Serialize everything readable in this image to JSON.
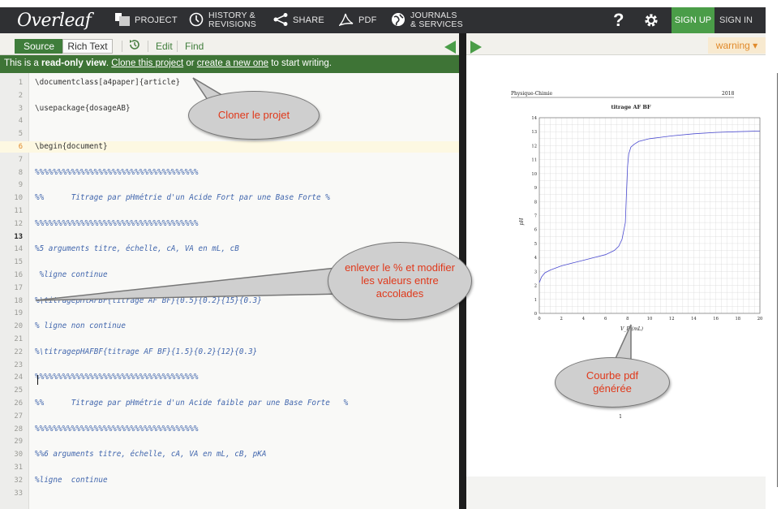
{
  "app": {
    "logo": "Overleaf"
  },
  "nav": {
    "project": "PROJECT",
    "history_line1": "HISTORY &",
    "history_line2": "REVISIONS",
    "share": "SHARE",
    "pdf": "PDF",
    "journals_line1": "JOURNALS",
    "journals_line2": "& SERVICES",
    "help": "?",
    "sign_up": "SIGN UP",
    "sign_in": "SIGN IN"
  },
  "toolbar": {
    "source": "Source",
    "rich_text": "Rich Text",
    "edit": "Edit",
    "find": "Find",
    "warning": "warning ▾"
  },
  "banner": {
    "prefix": "This is a ",
    "readonly": "read-only view",
    "sep1": ". ",
    "clone": "Clone this project",
    "or": " or ",
    "create": "create a new one",
    "suffix": " to start writing."
  },
  "editor": {
    "lines": [
      {
        "n": "1",
        "t": "\\documentclass[a4paper]{article}",
        "k": "code"
      },
      {
        "n": "2",
        "t": "",
        "k": "code"
      },
      {
        "n": "3",
        "t": "\\usepackage{dosageAB}",
        "k": "code"
      },
      {
        "n": "4",
        "t": "",
        "k": "code"
      },
      {
        "n": "5",
        "t": "",
        "k": "code"
      },
      {
        "n": "6",
        "t": "\\begin{document}",
        "k": "code"
      },
      {
        "n": "7",
        "t": "",
        "k": "code"
      },
      {
        "n": "8",
        "t": "%%%%%%%%%%%%%%%%%%%%%%%%%%%%%%%%%%%%",
        "k": "cmt"
      },
      {
        "n": "9",
        "t": "",
        "k": "code"
      },
      {
        "n": "10",
        "t": "%%      Titrage par pHmétrie d'un Acide Fort par une Base Forte %",
        "k": "cmt"
      },
      {
        "n": "11",
        "t": "",
        "k": "code"
      },
      {
        "n": "12",
        "t": "%%%%%%%%%%%%%%%%%%%%%%%%%%%%%%%%%%%%",
        "k": "cmt"
      },
      {
        "n": "13",
        "t": "",
        "k": "code"
      },
      {
        "n": "14",
        "t": "%5 arguments titre, échelle, cA, VA en mL, cB",
        "k": "cmt"
      },
      {
        "n": "15",
        "t": "",
        "k": "code"
      },
      {
        "n": "16",
        "t": " %ligne continue",
        "k": "cmt"
      },
      {
        "n": "17",
        "t": "",
        "k": "code"
      },
      {
        "n": "18",
        "t": "%\\titragepHlAFBF{titrage AF BF}{0.5}{0.2}{15}{0.3}",
        "k": "cmt"
      },
      {
        "n": "19",
        "t": "",
        "k": "code"
      },
      {
        "n": "20",
        "t": "% ligne non continue",
        "k": "cmt"
      },
      {
        "n": "21",
        "t": "",
        "k": "code"
      },
      {
        "n": "22",
        "t": "%\\titragepHAFBF{titrage AF BF}{1.5}{0.2}{12}{0.3}",
        "k": "cmt"
      },
      {
        "n": "23",
        "t": "",
        "k": "code"
      },
      {
        "n": "24",
        "t": "%%%%%%%%%%%%%%%%%%%%%%%%%%%%%%%%%%%%",
        "k": "cmt"
      },
      {
        "n": "25",
        "t": "",
        "k": "code"
      },
      {
        "n": "26",
        "t": "%%      Titrage par pHmétrie d'un Acide faible par une Base Forte   %",
        "k": "cmt"
      },
      {
        "n": "27",
        "t": "",
        "k": "code"
      },
      {
        "n": "28",
        "t": "%%%%%%%%%%%%%%%%%%%%%%%%%%%%%%%%%%%%",
        "k": "cmt"
      },
      {
        "n": "29",
        "t": "",
        "k": "code"
      },
      {
        "n": "30",
        "t": "%%6 arguments titre, échelle, cA, VA en mL, cB, pKA",
        "k": "cmt"
      },
      {
        "n": "31",
        "t": "",
        "k": "code"
      },
      {
        "n": "32",
        "t": "%ligne  continue",
        "k": "cmt"
      },
      {
        "n": "33",
        "t": "",
        "k": "code"
      }
    ]
  },
  "pdf": {
    "header_left": "Physique-Chimie",
    "header_right": "2018",
    "page_number": "1"
  },
  "chart_data": {
    "type": "line",
    "title": "titrage AF BF",
    "xlabel": "V_B (mL)",
    "ylabel": "pH",
    "xlim": [
      0,
      20
    ],
    "ylim": [
      0,
      14
    ],
    "xticks": [
      "0",
      "2",
      "4",
      "6",
      "8",
      "10",
      "12",
      "14",
      "16",
      "18",
      "20"
    ],
    "yticks": [
      "0",
      "1",
      "2",
      "3",
      "4",
      "5",
      "6",
      "7",
      "8",
      "9",
      "10",
      "11",
      "12",
      "13",
      "14"
    ],
    "grid": true,
    "series": [
      {
        "color": "#4b4bd0",
        "x": [
          0,
          0.2,
          0.5,
          1,
          2,
          3,
          4,
          5,
          6,
          6.8,
          7.2,
          7.5,
          7.8,
          7.9,
          8.0,
          8.1,
          8.3,
          8.6,
          9,
          10,
          11,
          12,
          14,
          16,
          18,
          20
        ],
        "y": [
          2.2,
          2.6,
          2.9,
          3.1,
          3.4,
          3.6,
          3.8,
          4.0,
          4.2,
          4.5,
          4.8,
          5.3,
          6.5,
          8.5,
          10.5,
          11.4,
          11.9,
          12.1,
          12.3,
          12.5,
          12.6,
          12.7,
          12.85,
          12.95,
          13.0,
          13.05
        ]
      }
    ]
  },
  "callouts": {
    "clone": "Cloner le projet",
    "edit_line1": "enlever le % et modifier",
    "edit_line2": "les valeurs entre",
    "edit_line3": "accolades",
    "pdf_line1": "Courbe pdf",
    "pdf_line2": "générée"
  }
}
